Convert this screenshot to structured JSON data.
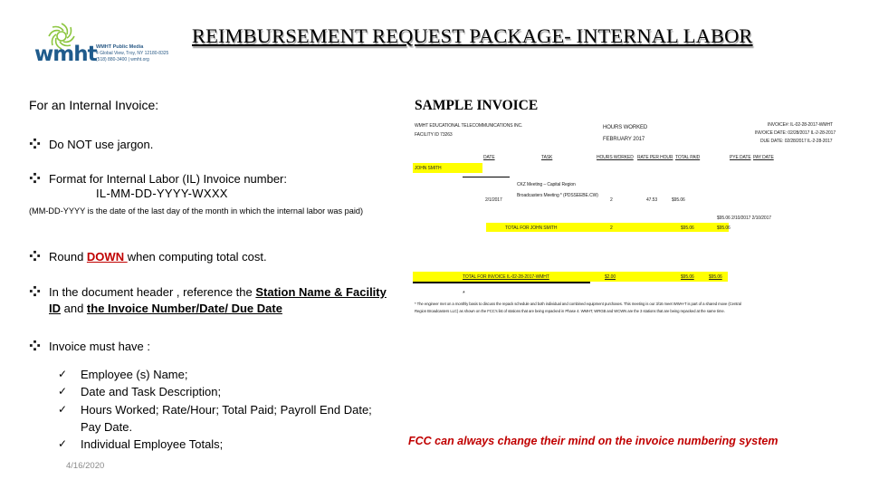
{
  "logo": {
    "brand": "wmht",
    "org": "WMHT Public Media",
    "address_line": "4 Global View, Troy, NY 12180-8325",
    "contact_line": "(518) 880-3400 | wmht.org",
    "brand_color": "#1f5b8c",
    "accent_color": "#8cc63f"
  },
  "title": "REIMBURSEMENT REQUEST PACKAGE- INTERNAL LABOR",
  "left": {
    "intro": "For an Internal Invoice:",
    "bullets": [
      {
        "text": "Do NOT use  jargon."
      },
      {
        "text": "Format for Internal Labor (IL) Invoice number:",
        "code": "IL-MM-DD-YYYY-WXXX",
        "note": "(MM-DD-YYYY is the date of the last day of the month in which the internal labor was paid)"
      },
      {
        "pre": "Round ",
        "emph": "DOWN ",
        "post": "when computing total cost."
      },
      {
        "pre": "In the document header , reference the ",
        "emph1": "Station Name & Facility ID",
        "mid": " and ",
        "emph2": "the Invoice Number/Date/ Due Date"
      },
      {
        "text": "Invoice must have :"
      }
    ],
    "checklist": [
      "Employee (s) Name;",
      "Date and Task Description;",
      "Hours Worked; Rate/Hour; Total Paid; Payroll End Date; Pay Date.",
      "Individual Employee Totals;"
    ]
  },
  "footer_date": "4/16/2020",
  "sample": {
    "heading": "SAMPLE INVOICE",
    "company": "WMHT EDUCATIONAL TELECOMMUNICATIONS INC.",
    "facility": "FACILITY ID 73263",
    "report_title": "HOURS WORKED",
    "period": "FEBRUARY 2017",
    "invoice_no": "INVOICE#: IL-02-28-2017-WMHT",
    "invoice_date": "INVOICE DATE: 02/28/2017 IL-2-28-2017",
    "due_date": "DUE DATE: 02/28/2017 IL-2-28-2017",
    "columns": [
      "DATE",
      "TASK",
      "HOURS WORKED",
      "RATE PER HOUR",
      "TOTAL PAID",
      "PYE DATE",
      "PAY DATE"
    ],
    "employee": "JOHN SMITH",
    "row": {
      "date": "2/1/2017",
      "task_line1": "CKZ Meeting – Capital Region",
      "task_line2": "Broadcasters Meeting * (PDSSEEBE.CW)",
      "hours": "2",
      "rate": "47.53",
      "total": "$95.06"
    },
    "pay_dates": "$95.06  2/10/2017   2/10/2017",
    "employee_total_label": "TOTAL FOR JOHN SMITH",
    "employee_total_hours": "2",
    "employee_total_paid": "$95.06",
    "employee_total_paid2": "$95.06",
    "invoice_total_label": "TOTAL FOR INVOICE IL-02-28-2017-WMHT",
    "invoice_total_hours": "$2.00",
    "invoice_total_paid": "$95.06",
    "invoice_total_paid2": "$95.06",
    "asterisk": "*",
    "footnote_line1": "* The engineer met on a monthly basis to discuss the repack schedule and both individual and combined equipment purchases. This meeting is our 3/16 meet WWH-T is part of a shared move (Central",
    "footnote_line2": "Region Broadcasters LLC) as shown on the FCC's list of stations that are being repacked in Phase 4. WMHT, WRGB and WCWN are the 3 stations that are being repacked at the same time."
  },
  "fcc_note": "FCC can always change their mind on the invoice numbering system"
}
